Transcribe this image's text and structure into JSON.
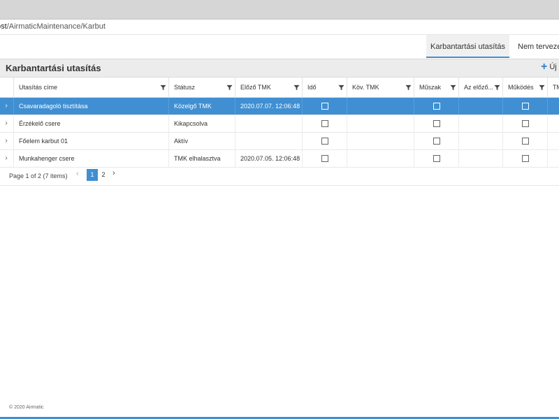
{
  "browser": {
    "url_host": "ost",
    "url_path": "/AirmaticMaintenance/Karbut"
  },
  "tabs": [
    {
      "label": "Karbantartási utasítás",
      "active": true
    },
    {
      "label": "Nem tervezett",
      "active": false
    }
  ],
  "panel": {
    "title": "Karbantartási utasítás",
    "new_label": "Új"
  },
  "grid": {
    "columns": [
      {
        "label": "Utasítás címe",
        "filter": true
      },
      {
        "label": "Státusz",
        "filter": true
      },
      {
        "label": "Előző TMK",
        "filter": true
      },
      {
        "label": "Idő",
        "filter": true
      },
      {
        "label": "Köv. TMK",
        "filter": true
      },
      {
        "label": "Műszak",
        "filter": true
      },
      {
        "label": "Az előző...",
        "filter": true
      },
      {
        "label": "Működés",
        "filter": true
      },
      {
        "label": "TM",
        "filter": false
      }
    ],
    "rows": [
      {
        "title": "Csavaradagoló tisztítása",
        "status": "Közelgő TMK",
        "prev_tmk": "2020.07.07. 12:06:48",
        "next_tmk": "",
        "selected": true
      },
      {
        "title": "Érzékelő csere",
        "status": "Kikapcsolva",
        "prev_tmk": "",
        "next_tmk": "",
        "selected": false
      },
      {
        "title": "Főelem karbut 01",
        "status": "Aktív",
        "prev_tmk": "",
        "next_tmk": "",
        "selected": false
      },
      {
        "title": "Munkahenger csere",
        "status": "TMK elhalasztva",
        "prev_tmk": "2020.07.05. 12:06:48",
        "next_tmk": "",
        "selected": false
      }
    ]
  },
  "pager": {
    "info": "Page 1 of 2 (7 items)",
    "pages": [
      "1",
      "2"
    ],
    "current_page": "1"
  },
  "footer": {
    "copyright": "© 2020 Airmatic"
  },
  "colors": {
    "accent": "#3f8fd2"
  },
  "icons": {
    "filter": "funnel-icon",
    "expand": "chevron-right-icon",
    "new": "plus-icon"
  }
}
